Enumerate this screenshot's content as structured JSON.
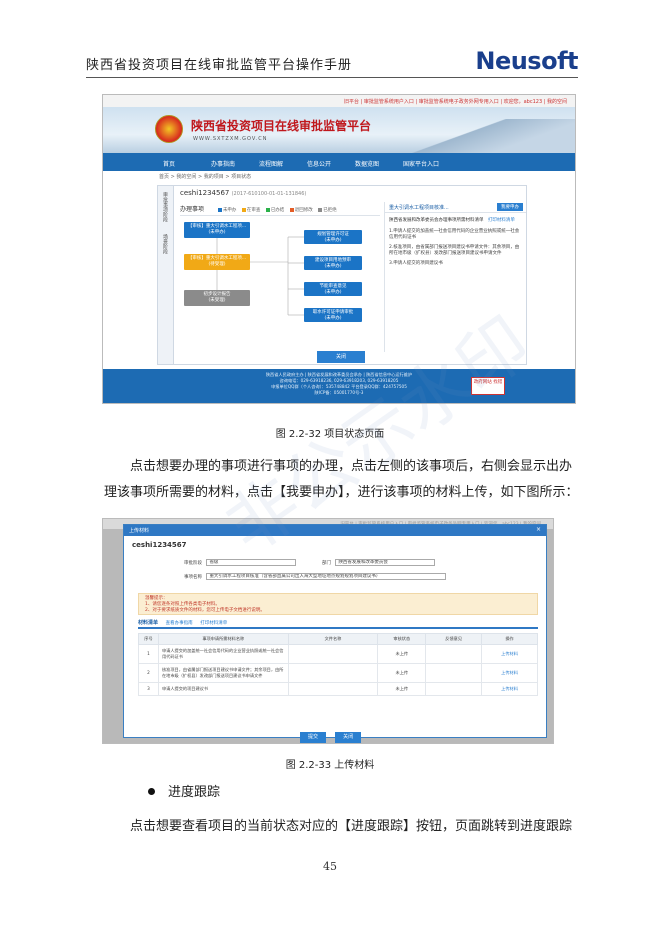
{
  "header": {
    "manual_title": "陕西省投资项目在线审批监管平台操作手册",
    "logo": "Neusoft"
  },
  "screenshot1": {
    "topbar": "旧平台 | 审批监管系统用户入口 | 审批监管系统电子政务外网专用入口 | 欢迎您，abc123 | 我的空间",
    "site_name": "陕西省投资项目在线审批监管平台",
    "site_url": "WWW.SXTZXM.GOV.CN",
    "nav": [
      "首页",
      "办事指南",
      "流程图解",
      "信息公开",
      "数据览图",
      "国家平台入口"
    ],
    "breadcrumb": "首页 > 我的空间 > 我的项目 > 项目状态",
    "side_tabs": [
      "审批事项阶段",
      "场景阶段"
    ],
    "project_title": "ceshi1234567",
    "project_code": "(2017-610100-01-01-131846)",
    "flow_head": "办理事项",
    "legend": [
      "未申办",
      "在审查",
      "已办结",
      "退回修改",
      "已拒绝"
    ],
    "nodes": {
      "n1": "【审核】重大引调水工程项...",
      "n1s": "(未申办)",
      "n2": "【审核】重大引调水工程项...",
      "n2s": "(待受理)",
      "n3": "初步设计报告",
      "n3s": "(未受理)",
      "r1": "规划管理许可证",
      "r1s": "(未申办)",
      "r2": "建设项目用地预审",
      "r2s": "(未申办)",
      "r3": "节能审查意见",
      "r3s": "(未申办)",
      "r4": "取水许可证申请审批",
      "r4s": "(未申办)"
    },
    "materials": {
      "head": "重大引调水工程项目核准...",
      "apply_button": "我要申办",
      "print_link": "打印材料清单",
      "subtitle": "陕西省发展和改革委员会办理事项所需材料清单",
      "items": [
        "1.申请人提交的加盖统一社会信用代码的企业营业执照或统一社会信用代码证书",
        "2.核准项目，由省属部门报送项目建议书申请文件：其余项目，由所在地市级（扩权县）发改部门报送项目建议书申请文件",
        "3.申请人提交的项目建议书"
      ]
    },
    "close_button": "关闭",
    "footer": [
      "陕西省人民政府主办 | 陕西省发展和改革委员会承办 | 陕西省信息中心运行维护",
      "咨询电话：029-63918236, 029-63918203, 029-63918205",
      "申报单位QQ群（个人咨询）：535748842 平台登录QQ群：424757505",
      "陕ICP备：05001770号-3"
    ],
    "footer_badge": "政府网站 找错"
  },
  "caption1": "图 2.2-32 项目状态页面",
  "paragraph1": "点击想要办理的事项进行事项的办理，点击左侧的该事项后，右侧会显示出办理该事项所需要的材料，点击【我要申办】，进行该事项的材料上传，如下图所示：",
  "screenshot2": {
    "modal_title": "上传材料",
    "project_title": "ceshi1234567",
    "labels": {
      "approval_dept": "审批阶段",
      "dept": "部门",
      "item_name": "事项名称"
    },
    "values": {
      "approval_dept": "省级",
      "dept": "陕西省发展和改革委员会",
      "item_name": "重大引调水工程项目核准（含省部直属公司出入海大型地址地点规划规划项目建议书）"
    },
    "notice": [
      "温馨提示：",
      "1、请您逐条对照上传各类电子材料。",
      "2、对于要求纸质文件的材料，您可上传电子文档进行说明。"
    ],
    "tabs": {
      "active": "材料清单",
      "links": [
        "查看办事指南",
        "打印材料清单"
      ]
    },
    "table": {
      "headers": [
        "序号",
        "事项申请所需材料名称",
        "文件名称",
        "审核状态",
        "反馈意见",
        "操作"
      ],
      "rows": [
        {
          "no": "1",
          "name": "申请人提交的加盖统一社会信用代码的企业营业执照或统一社会信用代码证书",
          "status": "未上传",
          "action": "上传材料"
        },
        {
          "no": "2",
          "name": "核准项目，由省属部门报送项目建议书申请文件；其余项目，由所在地市级（扩权县）发改部门报送项目建议书申请文件",
          "status": "未上传",
          "action": "上传材料"
        },
        {
          "no": "3",
          "name": "申请人提交的项目建议书",
          "status": "未上传",
          "action": "上传材料"
        }
      ]
    },
    "buttons": {
      "submit": "提交",
      "close": "关闭"
    }
  },
  "caption2": "图 2.2-33 上传材料",
  "bullet": "进度跟踪",
  "paragraph2": "点击想要查看项目的当前状态对应的【进度跟踪】按钮，页面跳转到进度跟踪",
  "page_number": "45",
  "watermark": "非公示水印"
}
